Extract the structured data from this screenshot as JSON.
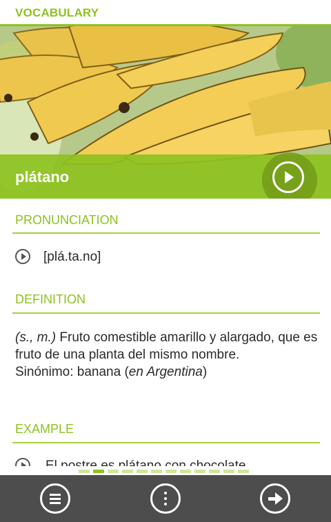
{
  "header": {
    "title": "VOCABULARY"
  },
  "hero": {
    "word": "plátano",
    "image": "bananas-photo"
  },
  "pronunciation": {
    "heading": "PRONUNCIATION",
    "text": "[plá.ta.no]",
    "icon": "play-icon"
  },
  "definition": {
    "heading": "DEFINITION",
    "category": "(s., m.)",
    "text": " Fruto comestible amarillo y alargado, que es fruto de una planta del mismo nombre.",
    "synonym_prefix": "Sinónimo: banana (",
    "synonym_region": "en Argentina",
    "synonym_suffix": ")"
  },
  "example": {
    "heading": "EXAMPLE",
    "text": "El postre es plátano con chocolate."
  },
  "pager": {
    "count": 12,
    "active_index": 1
  },
  "bottom_nav": {
    "menu": "menu-icon",
    "more": "more-icon",
    "next": "next-arrow-icon"
  },
  "colors": {
    "accent": "#8dc21f",
    "bottom_bar": "#4d4d4d",
    "text": "#2a2a2a"
  }
}
